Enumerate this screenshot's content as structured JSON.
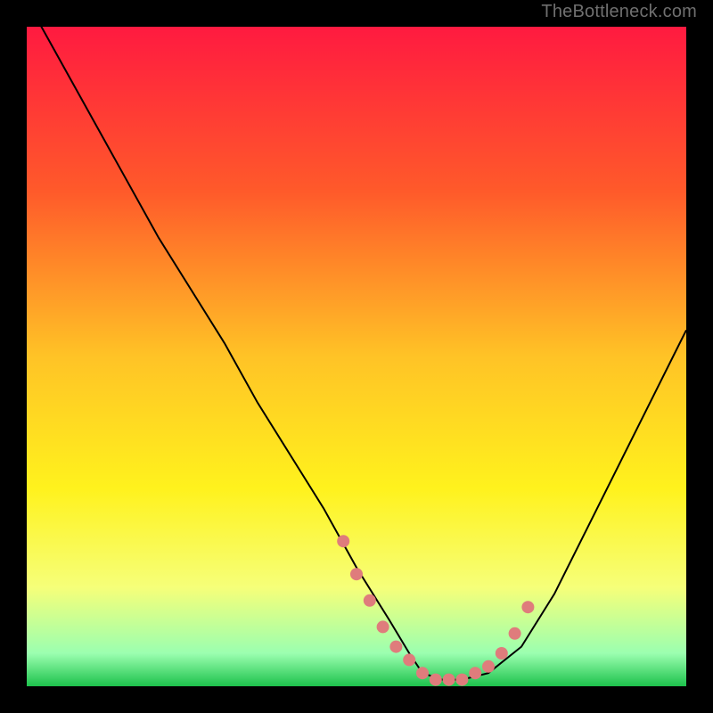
{
  "watermark": "TheBottleneck.com",
  "chart_data": {
    "type": "line",
    "title": "",
    "xlabel": "",
    "ylabel": "",
    "xlim": [
      0,
      100
    ],
    "ylim": [
      0,
      100
    ],
    "background_gradient": {
      "stops": [
        {
          "offset": 0,
          "color": "#ff1a40"
        },
        {
          "offset": 25,
          "color": "#ff5a2a"
        },
        {
          "offset": 50,
          "color": "#ffc326"
        },
        {
          "offset": 70,
          "color": "#fff21d"
        },
        {
          "offset": 85,
          "color": "#f6ff79"
        },
        {
          "offset": 95,
          "color": "#9bffb0"
        },
        {
          "offset": 100,
          "color": "#1dc24c"
        }
      ]
    },
    "series": [
      {
        "name": "curve",
        "color": "#000000",
        "x": [
          0,
          5,
          10,
          15,
          20,
          25,
          30,
          35,
          40,
          45,
          50,
          55,
          58,
          60,
          63,
          66,
          70,
          75,
          80,
          85,
          90,
          95,
          100
        ],
        "y": [
          104,
          95,
          86,
          77,
          68,
          60,
          52,
          43,
          35,
          27,
          18,
          10,
          5,
          2,
          1,
          1,
          2,
          6,
          14,
          24,
          34,
          44,
          54
        ]
      },
      {
        "name": "markers",
        "color": "#df7c7c",
        "x": [
          48,
          50,
          52,
          54,
          56,
          58,
          60,
          62,
          64,
          66,
          68,
          70,
          72,
          74,
          76
        ],
        "y": [
          22,
          17,
          13,
          9,
          6,
          4,
          2,
          1,
          1,
          1,
          2,
          3,
          5,
          8,
          12
        ]
      }
    ]
  }
}
